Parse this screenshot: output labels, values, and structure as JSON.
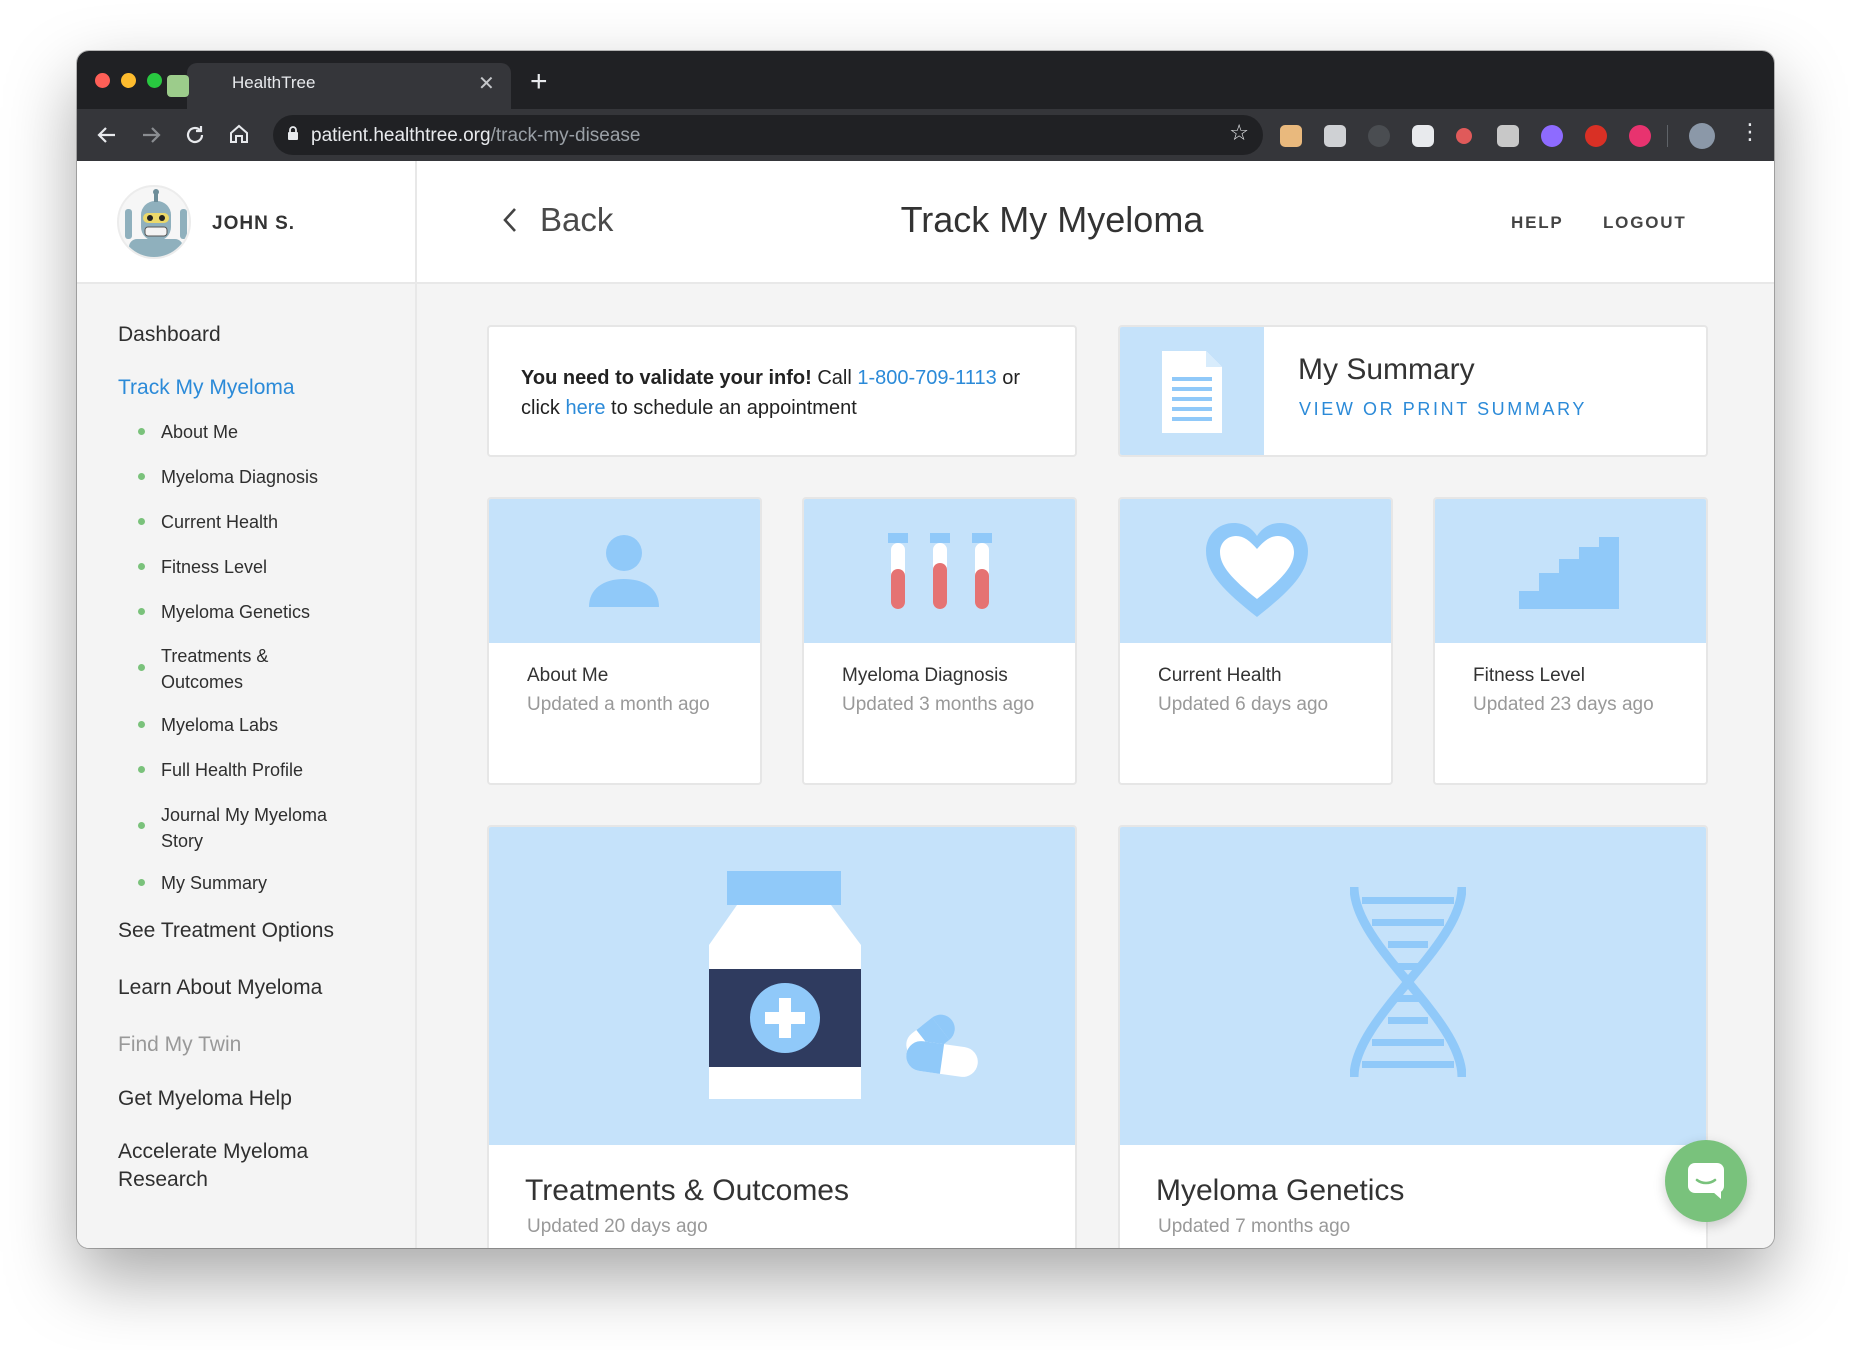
{
  "browser": {
    "tab_title": "HealthTree",
    "url_host": "patient.healthtree.org",
    "url_path": "/track-my-disease"
  },
  "header": {
    "user_name": "JOHN S.",
    "back_label": "Back",
    "title": "Track My Myeloma",
    "help": "HELP",
    "logout": "LOGOUT"
  },
  "sidebar": {
    "dashboard": "Dashboard",
    "track": "Track My Myeloma",
    "sub_items": [
      "About Me",
      "Myeloma Diagnosis",
      "Current Health",
      "Fitness Level",
      "Myeloma Genetics",
      "Treatments & Outcomes",
      "Myeloma Labs",
      "Full Health Profile",
      "Journal My Myeloma Story",
      "My Summary"
    ],
    "see_treatment": "See Treatment Options",
    "learn": "Learn About Myeloma",
    "find_twin": "Find My Twin",
    "get_help": "Get Myeloma Help",
    "accelerate": "Accelerate Myeloma Research"
  },
  "alert": {
    "bold": "You need to validate your info!",
    "call": " Call ",
    "phone": "1-800-709-1113",
    "or_click": " or click ",
    "here": "here",
    "rest": " to schedule an appointment"
  },
  "summary": {
    "title": "My Summary",
    "link": "VIEW OR PRINT SUMMARY"
  },
  "tiles": [
    {
      "title": "About Me",
      "updated": "Updated a month ago"
    },
    {
      "title": "Myeloma Diagnosis",
      "updated": "Updated 3 months ago"
    },
    {
      "title": "Current Health",
      "updated": "Updated 6 days ago"
    },
    {
      "title": "Fitness Level",
      "updated": "Updated 23 days ago"
    }
  ],
  "big_cards": [
    {
      "title": "Treatments & Outcomes",
      "updated": "Updated 20 days ago"
    },
    {
      "title": "Myeloma Genetics",
      "updated": "Updated 7 months ago"
    }
  ],
  "colors": {
    "accent": "#2b8ad8",
    "tile_bg": "#c5e2fa",
    "icon_blue": "#90c9f9",
    "green": "#79c27c",
    "navy": "#2f3b5f",
    "tube_red": "#e57373"
  }
}
